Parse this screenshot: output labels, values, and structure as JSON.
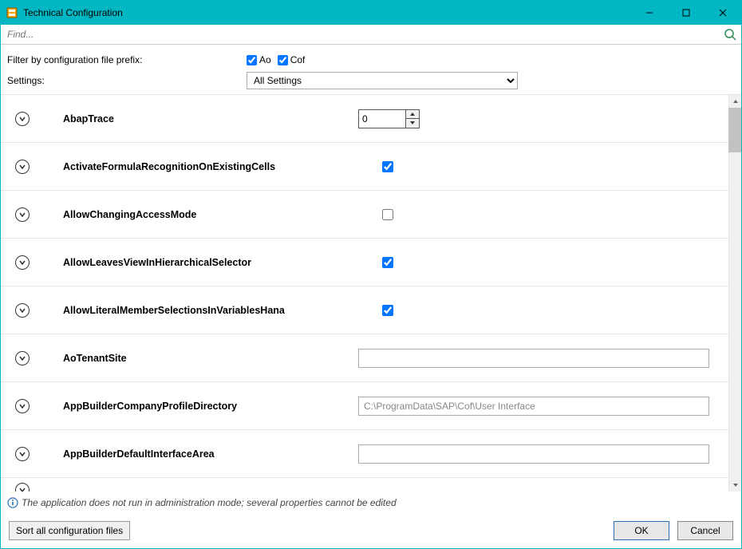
{
  "window": {
    "title": "Technical Configuration"
  },
  "search": {
    "placeholder": "Find..."
  },
  "filter": {
    "label": "Filter by configuration file prefix:",
    "ao": {
      "label": "Ao",
      "checked": true
    },
    "cof": {
      "label": "Cof",
      "checked": true
    },
    "settings_label": "Settings:",
    "settings_value": "All Settings"
  },
  "rows": [
    {
      "name": "AbapTrace",
      "type": "number",
      "value": "0"
    },
    {
      "name": "ActivateFormulaRecognitionOnExistingCells",
      "type": "checkbox",
      "checked": true
    },
    {
      "name": "AllowChangingAccessMode",
      "type": "checkbox",
      "checked": false
    },
    {
      "name": "AllowLeavesViewInHierarchicalSelector",
      "type": "checkbox",
      "checked": true
    },
    {
      "name": "AllowLiteralMemberSelectionsInVariablesHana",
      "type": "checkbox",
      "checked": true
    },
    {
      "name": "AoTenantSite",
      "type": "text",
      "value": ""
    },
    {
      "name": "AppBuilderCompanyProfileDirectory",
      "type": "text",
      "value": "C:\\ProgramData\\SAP\\Cof\\User Interface",
      "readonly": true
    },
    {
      "name": "AppBuilderDefaultInterfaceArea",
      "type": "text",
      "value": ""
    }
  ],
  "status": {
    "text": "The application does not run in administration mode; several properties cannot be edited"
  },
  "footer": {
    "sort_label": "Sort all configuration files",
    "ok_label": "OK",
    "cancel_label": "Cancel"
  }
}
